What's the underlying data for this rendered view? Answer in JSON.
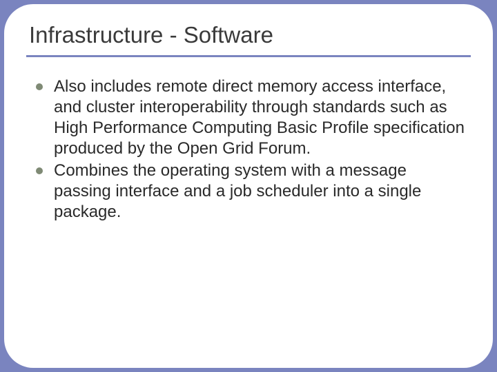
{
  "title": "Infrastructure - Software",
  "bullets": [
    "Also includes remote direct memory access interface, and cluster interoperability through standards such as High Performance Computing Basic Profile specification produced by the Open Grid Forum.",
    "Combines the operating system with a message passing interface and a job scheduler into a single package."
  ]
}
